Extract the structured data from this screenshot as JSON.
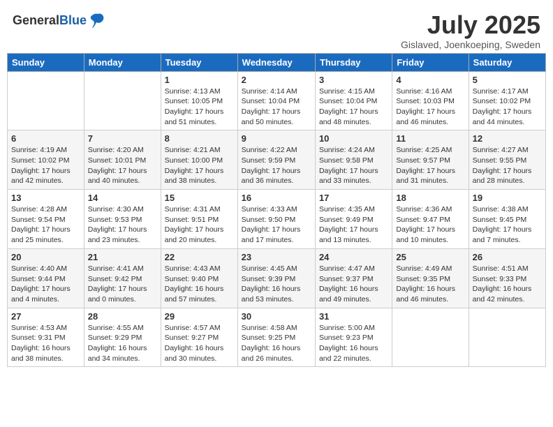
{
  "header": {
    "logo_general": "General",
    "logo_blue": "Blue",
    "month_title": "July 2025",
    "subtitle": "Gislaved, Joenkoeping, Sweden"
  },
  "days_of_week": [
    "Sunday",
    "Monday",
    "Tuesday",
    "Wednesday",
    "Thursday",
    "Friday",
    "Saturday"
  ],
  "weeks": [
    [
      {
        "day": "",
        "detail": ""
      },
      {
        "day": "",
        "detail": ""
      },
      {
        "day": "1",
        "detail": "Sunrise: 4:13 AM\nSunset: 10:05 PM\nDaylight: 17 hours and 51 minutes."
      },
      {
        "day": "2",
        "detail": "Sunrise: 4:14 AM\nSunset: 10:04 PM\nDaylight: 17 hours and 50 minutes."
      },
      {
        "day": "3",
        "detail": "Sunrise: 4:15 AM\nSunset: 10:04 PM\nDaylight: 17 hours and 48 minutes."
      },
      {
        "day": "4",
        "detail": "Sunrise: 4:16 AM\nSunset: 10:03 PM\nDaylight: 17 hours and 46 minutes."
      },
      {
        "day": "5",
        "detail": "Sunrise: 4:17 AM\nSunset: 10:02 PM\nDaylight: 17 hours and 44 minutes."
      }
    ],
    [
      {
        "day": "6",
        "detail": "Sunrise: 4:19 AM\nSunset: 10:02 PM\nDaylight: 17 hours and 42 minutes."
      },
      {
        "day": "7",
        "detail": "Sunrise: 4:20 AM\nSunset: 10:01 PM\nDaylight: 17 hours and 40 minutes."
      },
      {
        "day": "8",
        "detail": "Sunrise: 4:21 AM\nSunset: 10:00 PM\nDaylight: 17 hours and 38 minutes."
      },
      {
        "day": "9",
        "detail": "Sunrise: 4:22 AM\nSunset: 9:59 PM\nDaylight: 17 hours and 36 minutes."
      },
      {
        "day": "10",
        "detail": "Sunrise: 4:24 AM\nSunset: 9:58 PM\nDaylight: 17 hours and 33 minutes."
      },
      {
        "day": "11",
        "detail": "Sunrise: 4:25 AM\nSunset: 9:57 PM\nDaylight: 17 hours and 31 minutes."
      },
      {
        "day": "12",
        "detail": "Sunrise: 4:27 AM\nSunset: 9:55 PM\nDaylight: 17 hours and 28 minutes."
      }
    ],
    [
      {
        "day": "13",
        "detail": "Sunrise: 4:28 AM\nSunset: 9:54 PM\nDaylight: 17 hours and 25 minutes."
      },
      {
        "day": "14",
        "detail": "Sunrise: 4:30 AM\nSunset: 9:53 PM\nDaylight: 17 hours and 23 minutes."
      },
      {
        "day": "15",
        "detail": "Sunrise: 4:31 AM\nSunset: 9:51 PM\nDaylight: 17 hours and 20 minutes."
      },
      {
        "day": "16",
        "detail": "Sunrise: 4:33 AM\nSunset: 9:50 PM\nDaylight: 17 hours and 17 minutes."
      },
      {
        "day": "17",
        "detail": "Sunrise: 4:35 AM\nSunset: 9:49 PM\nDaylight: 17 hours and 13 minutes."
      },
      {
        "day": "18",
        "detail": "Sunrise: 4:36 AM\nSunset: 9:47 PM\nDaylight: 17 hours and 10 minutes."
      },
      {
        "day": "19",
        "detail": "Sunrise: 4:38 AM\nSunset: 9:45 PM\nDaylight: 17 hours and 7 minutes."
      }
    ],
    [
      {
        "day": "20",
        "detail": "Sunrise: 4:40 AM\nSunset: 9:44 PM\nDaylight: 17 hours and 4 minutes."
      },
      {
        "day": "21",
        "detail": "Sunrise: 4:41 AM\nSunset: 9:42 PM\nDaylight: 17 hours and 0 minutes."
      },
      {
        "day": "22",
        "detail": "Sunrise: 4:43 AM\nSunset: 9:40 PM\nDaylight: 16 hours and 57 minutes."
      },
      {
        "day": "23",
        "detail": "Sunrise: 4:45 AM\nSunset: 9:39 PM\nDaylight: 16 hours and 53 minutes."
      },
      {
        "day": "24",
        "detail": "Sunrise: 4:47 AM\nSunset: 9:37 PM\nDaylight: 16 hours and 49 minutes."
      },
      {
        "day": "25",
        "detail": "Sunrise: 4:49 AM\nSunset: 9:35 PM\nDaylight: 16 hours and 46 minutes."
      },
      {
        "day": "26",
        "detail": "Sunrise: 4:51 AM\nSunset: 9:33 PM\nDaylight: 16 hours and 42 minutes."
      }
    ],
    [
      {
        "day": "27",
        "detail": "Sunrise: 4:53 AM\nSunset: 9:31 PM\nDaylight: 16 hours and 38 minutes."
      },
      {
        "day": "28",
        "detail": "Sunrise: 4:55 AM\nSunset: 9:29 PM\nDaylight: 16 hours and 34 minutes."
      },
      {
        "day": "29",
        "detail": "Sunrise: 4:57 AM\nSunset: 9:27 PM\nDaylight: 16 hours and 30 minutes."
      },
      {
        "day": "30",
        "detail": "Sunrise: 4:58 AM\nSunset: 9:25 PM\nDaylight: 16 hours and 26 minutes."
      },
      {
        "day": "31",
        "detail": "Sunrise: 5:00 AM\nSunset: 9:23 PM\nDaylight: 16 hours and 22 minutes."
      },
      {
        "day": "",
        "detail": ""
      },
      {
        "day": "",
        "detail": ""
      }
    ]
  ]
}
